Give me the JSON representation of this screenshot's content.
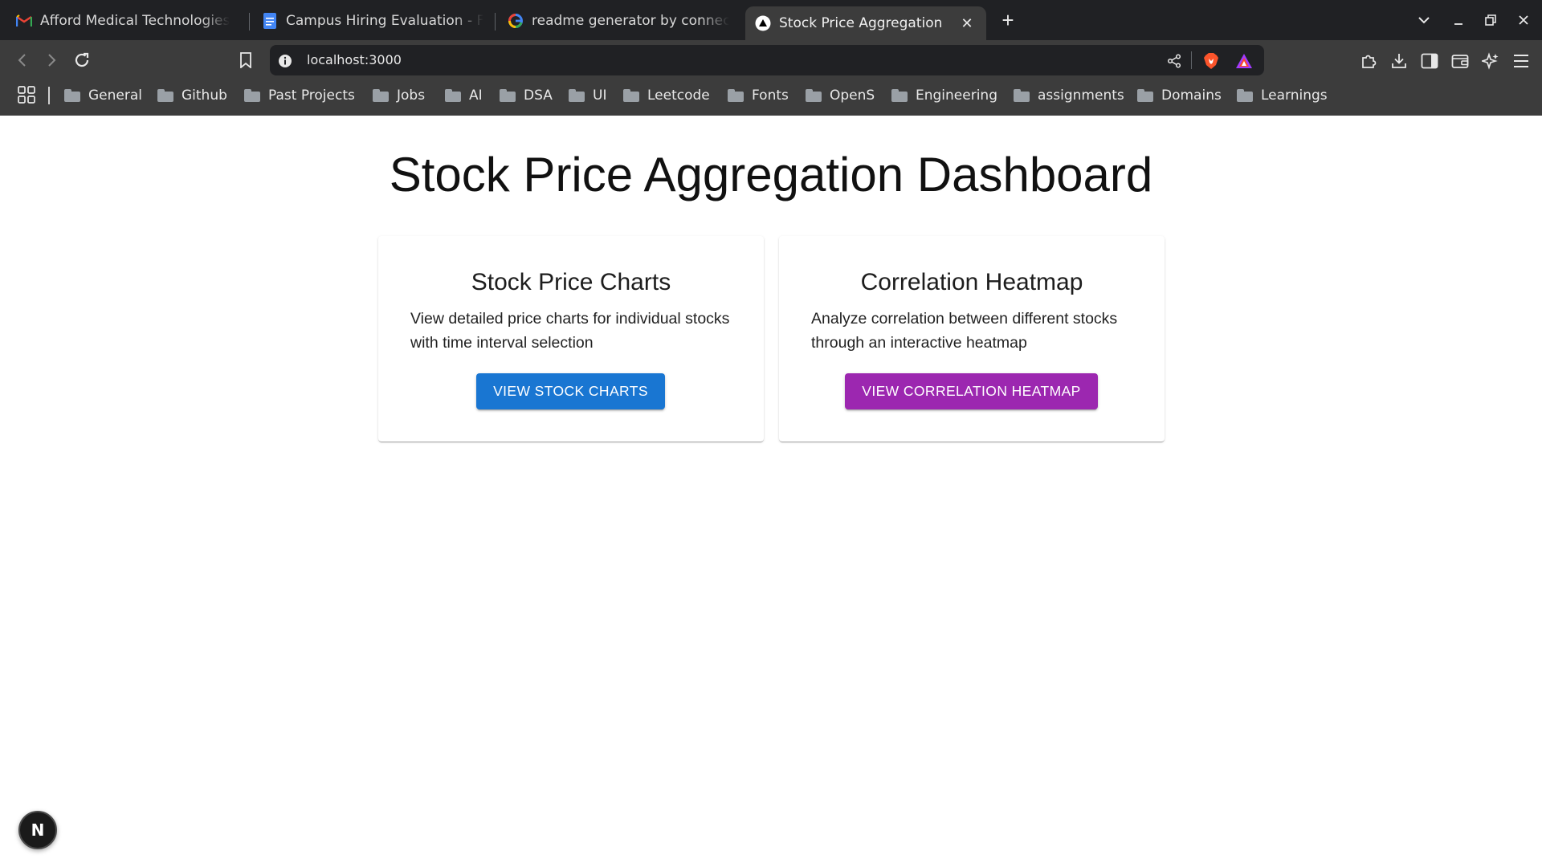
{
  "browser": {
    "tabs": [
      {
        "title": "Afford Medical Technologies",
        "favicon": "gmail-icon"
      },
      {
        "title": "Campus Hiring Evaluation - Fu",
        "favicon": "docs-icon"
      },
      {
        "title": "readme generator by connec",
        "favicon": "google-icon"
      },
      {
        "title": "Stock Price Aggregation",
        "favicon": "nextjs-triangle-icon",
        "active": true
      }
    ],
    "url": "localhost:3000",
    "bookmarks": [
      "General",
      "Github",
      "Past Projects",
      "Jobs",
      "AI",
      "DSA",
      "UI",
      "Leetcode",
      "Fonts",
      "OpenS",
      "Engineering",
      "assignments",
      "Domains",
      "Learnings"
    ]
  },
  "page": {
    "title": "Stock Price Aggregation Dashboard",
    "cards": [
      {
        "title": "Stock Price Charts",
        "description": "View detailed price charts for individual stocks with time interval selection",
        "button": "VIEW STOCK CHARTS",
        "button_color": "#1976d2"
      },
      {
        "title": "Correlation Heatmap",
        "description": "Analyze correlation between different stocks through an interactive heatmap",
        "button": "VIEW CORRELATION HEATMAP",
        "button_color": "#9c27b0"
      }
    ]
  },
  "dev_badge": {
    "label": "N",
    "icon": "nextjs-devtools-icon"
  },
  "colors": {
    "chrome_dark": "#202124",
    "chrome_toolbar": "#3c3c3c",
    "primary": "#1976d2",
    "secondary": "#9c27b0"
  }
}
